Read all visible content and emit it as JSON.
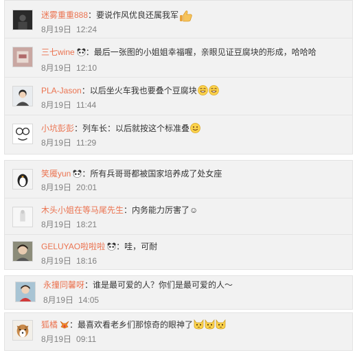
{
  "panels": [
    {
      "comments": [
        {
          "name": "迷雾重重888",
          "vip": false,
          "text": "要说作风优良还属我军",
          "emojis": [
            "thumbs-up-icon"
          ],
          "date": "8月19日",
          "time": "12:24",
          "avatar": "dark-photo"
        },
        {
          "name": "三七wine",
          "vip": true,
          "text": "最后一张图的小姐姐幸福喔，亲眼见证豆腐块的形成，哈哈哈",
          "emojis": [],
          "date": "8月19日",
          "time": "12:10",
          "avatar": "pink-photo"
        },
        {
          "name": "PLA-Jason",
          "vip": false,
          "text": "以后坐火车我也要叠个豆腐块",
          "emojis": [
            "laugh-face-icon",
            "laugh-face-icon"
          ],
          "date": "8月19日",
          "time": "11:44",
          "avatar": "man-photo"
        },
        {
          "name": "小坑彭彭",
          "vip": false,
          "text": "列车长：以后就按这个标准叠",
          "emojis": [
            "smile-face-icon"
          ],
          "date": "8月19日",
          "time": "11:29",
          "avatar": "cartoon-photo"
        }
      ]
    },
    {
      "comments": [
        {
          "name": "笑魇yun",
          "vip": true,
          "text": "所有兵哥哥都被国家培养成了处女座",
          "emojis": [],
          "date": "8月19日",
          "time": "20:01",
          "avatar": "penguin-photo"
        },
        {
          "name": "木头小姐在等马尾先生",
          "vip": false,
          "text": "内务能力厉害了☺",
          "emojis": [],
          "date": "8月19日",
          "time": "18:21",
          "avatar": "plain-photo"
        },
        {
          "name": "GELUYAO啦啦啦",
          "vip": true,
          "text": "哇，可耐",
          "emojis": [],
          "date": "8月19日",
          "time": "18:16",
          "avatar": "girl-photo"
        }
      ]
    },
    {
      "comments": [
        {
          "name": "永撞同馨呀",
          "vip": false,
          "text": "谁是最可爱的人？你们是最可爱的人～",
          "emojis": [],
          "date": "8月19日",
          "time": "14:05",
          "avatar": "woman-photo"
        }
      ]
    },
    {
      "comments": [
        {
          "name": "狐橘",
          "vip": true,
          "text": "最喜欢看老乡们那惊奇的眼神了",
          "emojis": [
            "cat-face-icon",
            "cat-face-icon",
            "cat-face-icon"
          ],
          "date": "8月19日",
          "time": "09:11",
          "avatar": "dog-photo",
          "badge": "fox-badge-icon"
        }
      ]
    }
  ],
  "colors": {
    "name": "#eb7350",
    "text": "#333333",
    "time": "#808080",
    "panel_bg": "#f2f2f2"
  }
}
